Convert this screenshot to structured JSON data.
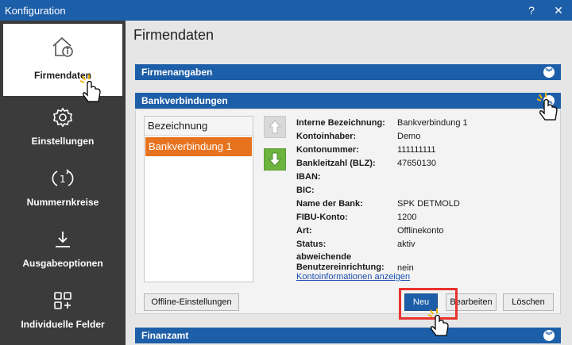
{
  "window": {
    "title": "Konfiguration",
    "help_label": "?",
    "close_label": "✕"
  },
  "sidebar": {
    "items": [
      {
        "label": "Firmendaten",
        "icon": "home-info-icon",
        "active": true
      },
      {
        "label": "Einstellungen",
        "icon": "gear-icon"
      },
      {
        "label": "Nummernkreise",
        "icon": "cycle-one-icon"
      },
      {
        "label": "Ausgabeoptionen",
        "icon": "download-icon"
      },
      {
        "label": "Individuelle Felder",
        "icon": "grid-add-icon"
      }
    ]
  },
  "main": {
    "title": "Firmendaten",
    "sections": {
      "firmenangaben": "Firmenangaben",
      "bankverbindungen": "Bankverbindungen",
      "finanzamt": "Finanzamt"
    },
    "bank": {
      "list_header": "Bezeichnung",
      "list_items": [
        "Bankverbindung 1"
      ],
      "details": [
        {
          "label": "Interne Bezeichnung:",
          "value": "Bankverbindung 1"
        },
        {
          "label": "Kontoinhaber:",
          "value": "Demo"
        },
        {
          "label": "Kontonummer:",
          "value": "111111111"
        },
        {
          "label": "Bankleitzahl (BLZ):",
          "value": "47650130"
        },
        {
          "label": "IBAN:",
          "value": ""
        },
        {
          "label": "BIC:",
          "value": ""
        },
        {
          "label": "Name der Bank:",
          "value": "SPK DETMOLD"
        },
        {
          "label": "FIBU-Konto:",
          "value": "1200"
        },
        {
          "label": "Art:",
          "value": "Offlinekonto"
        },
        {
          "label": "Status:",
          "value": "aktiv"
        },
        {
          "label": "abweichende Benutzereinrichtung:",
          "value": "nein"
        }
      ],
      "link": "Kontoinformationen anzeigen",
      "buttons": {
        "offline": "Offline-Einstellungen",
        "neu": "Neu",
        "bearbeiten": "Bearbeiten",
        "loeschen": "Löschen"
      }
    }
  },
  "colors": {
    "accent": "#1d5ea8",
    "sidebar": "#3b3b3b",
    "selected": "#e8731f",
    "highlight": "#e9322e",
    "green": "#6cb33f"
  }
}
